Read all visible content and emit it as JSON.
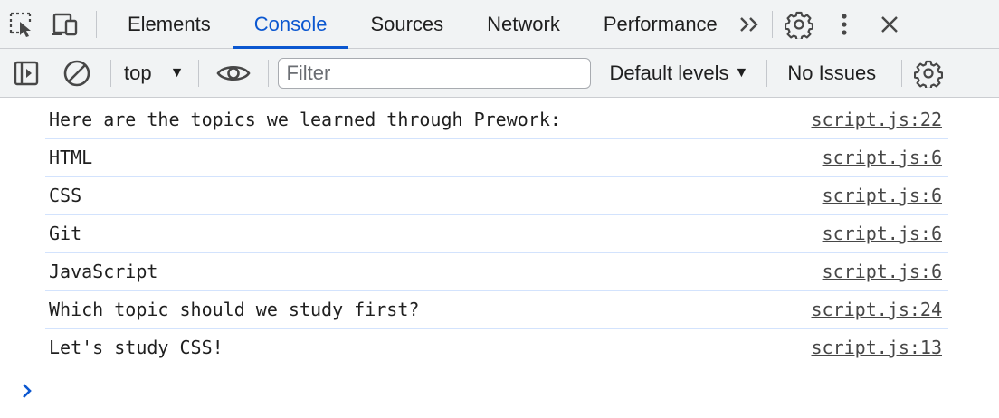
{
  "tabs": [
    {
      "label": "Elements",
      "active": false
    },
    {
      "label": "Console",
      "active": true
    },
    {
      "label": "Sources",
      "active": false
    },
    {
      "label": "Network",
      "active": false
    },
    {
      "label": "Performance",
      "active": false
    }
  ],
  "top_icons": [
    "inspect-element-icon",
    "device-toolbar-icon",
    "more-tabs-icon",
    "settings-icon",
    "kebab-menu-icon",
    "close-icon"
  ],
  "toolbar": {
    "context": "top",
    "filter_value": "",
    "filter_placeholder": "Filter",
    "levels": "Default levels",
    "issues": "No Issues",
    "icons": [
      "sidebar-toggle-icon",
      "clear-console-icon",
      "live-expression-eye-icon",
      "console-settings-icon"
    ]
  },
  "messages": [
    {
      "text": "Here are the topics we learned through Prework:",
      "source": "script.js:22"
    },
    {
      "text": "HTML",
      "source": "script.js:6"
    },
    {
      "text": "CSS",
      "source": "script.js:6"
    },
    {
      "text": "Git",
      "source": "script.js:6"
    },
    {
      "text": "JavaScript",
      "source": "script.js:6"
    },
    {
      "text": "Which topic should we study first?",
      "source": "script.js:24"
    },
    {
      "text": "Let's study CSS!",
      "source": "script.js:13"
    }
  ],
  "prompt_icon": "chevron-right-icon",
  "colors": {
    "accent": "#0b57d0",
    "toolbar_bg": "#f1f3f4",
    "row_border": "#d3e3fd"
  }
}
